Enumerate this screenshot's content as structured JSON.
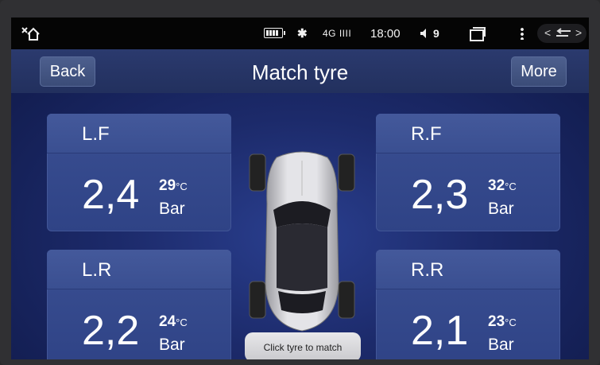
{
  "statusbar": {
    "network": "4G IIII",
    "time": "18:00",
    "volume": "9",
    "nav_left": "<",
    "nav_right": ">"
  },
  "titlebar": {
    "back_label": "Back",
    "title": "Match tyre",
    "more_label": "More"
  },
  "tyres": {
    "lf": {
      "position": "L.F",
      "pressure": "2,4",
      "temp": "29",
      "temp_unit": "°C",
      "unit": "Bar"
    },
    "rf": {
      "position": "R.F",
      "pressure": "2,3",
      "temp": "32",
      "temp_unit": "°C",
      "unit": "Bar"
    },
    "lr": {
      "position": "L.R",
      "pressure": "2,2",
      "temp": "24",
      "temp_unit": "°C",
      "unit": "Bar"
    },
    "rr": {
      "position": "R.R",
      "pressure": "2,1",
      "temp": "23",
      "temp_unit": "°C",
      "unit": "Bar"
    }
  },
  "match_button_label": "Click tyre to match",
  "icons": {
    "home": "home-close-icon",
    "battery": "battery-icon",
    "bluetooth": "bluetooth-icon",
    "volume": "volume-icon",
    "windows": "recent-apps-icon",
    "menu": "more-vert-icon",
    "return": "return-icon"
  }
}
